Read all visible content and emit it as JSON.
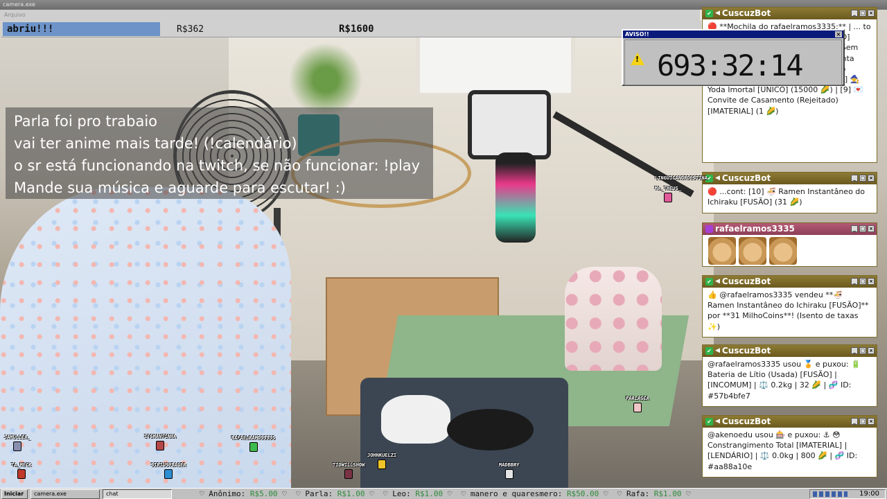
{
  "window": {
    "title": "camera.exe",
    "subtitle": "Arquivo"
  },
  "goal": {
    "label": "abriu!!!",
    "current": "R$362",
    "target": "R$1600",
    "progress_fraction": 0.226,
    "fill_color": "#6d93c9"
  },
  "info_lines": [
    "Parla foi pro trabaio",
    "vai ter anime mais tarde! (!calendário)",
    "o sr está funcionando na twitch, se não funcionar: !play",
    "Mande sua música e aguarde para escutar! :)"
  ],
  "aviso": {
    "title": "AVISO!!",
    "timer": "693:32:14",
    "icon": "warning-icon"
  },
  "panels": [
    {
      "user": "CuscuzBot",
      "text": "🔴 **Mochila do rafaelramos3335:** | ... to ... dex ... 0 ... 15000 ... gada) [ÉPICO] (1750 🌽) | [5] ⚔️ Sabre de Pirata (Sem Ponta) (1000 🌽) | [6] 🎨 Lata de Tinta (Mario) [RARO] (500 🌽) | [7] 🥶 Frio Congelante [IMATERIAL] (23 🌽) | [8] 🧙 Yoda Imortal [ÚNICO] (15000 🌽) | [9] 💌 Convite de Casamento (Rejeitado) [IMATERIAL] (1 🌽)"
    },
    {
      "user": "CuscuzBot",
      "text": "🔴 ...cont: [10] 🍜 Ramen Instantâneo do Ichiraku [FUSÃO] (31 🌽)"
    },
    {
      "user": "rafaelramos3335",
      "text": ""
    },
    {
      "user": "CuscuzBot",
      "text": "👍 @rafaelramos3335 vendeu **🍜 Ramen Instantâneo do Ichiraku [FUSÃO]** por **31 MilhoCoins**! (Isento de taxas ✨)"
    },
    {
      "user": "CuscuzBot",
      "text": "@rafaelramos3335 usou 🏅 e puxou: 🔋 Bateria de Lítio (Usada) [FUSÃO] | [INCOMUM] | ⚖️ 0.2kg | 32 🌽 | 🧬 ID: #57b4bfe7"
    },
    {
      "user": "CuscuzBot",
      "text": "@akenoedu usou 🎰 e puxou: ⚓ 😳 Constrangimento Total [IMATERIAL] | [LENDÁRIO] | ⚖️ 0.0kg | 800 🌽 | 🧬 ID: #aa88a10e"
    }
  ],
  "taskbar": {
    "start": "Iniciar",
    "tasks": [
      "camera.exe",
      "chat"
    ],
    "ticker": [
      {
        "name": "Anônimo:",
        "amount": "R$5.00"
      },
      {
        "name": "Parla:",
        "amount": "R$1.00"
      },
      {
        "name": "Leo:",
        "amount": "R$1.00"
      },
      {
        "name": "manero e quaresmero:",
        "amount": "R$50.00"
      },
      {
        "name": "Rafa:",
        "amount": "R$1.00"
      }
    ],
    "clock": "19:00"
  },
  "chatters": [
    "LINGUICANORDESTINA",
    "MA_THEUS_",
    "PARLASEA",
    "JAMULLER_",
    "TA_MECK",
    "ITSMANTINHA",
    "SIRIUSYBAGER",
    "RAFAELRAMOS3335",
    "JOHNKUELZI",
    "TIOWILLSHOW",
    "MADBBRY"
  ],
  "colors": {
    "panel_title": "#8d7a34",
    "panel_title_user": "#b45a74",
    "aviso_title": "#0a1a7a",
    "ticker_amount": "#2f8a3a"
  }
}
